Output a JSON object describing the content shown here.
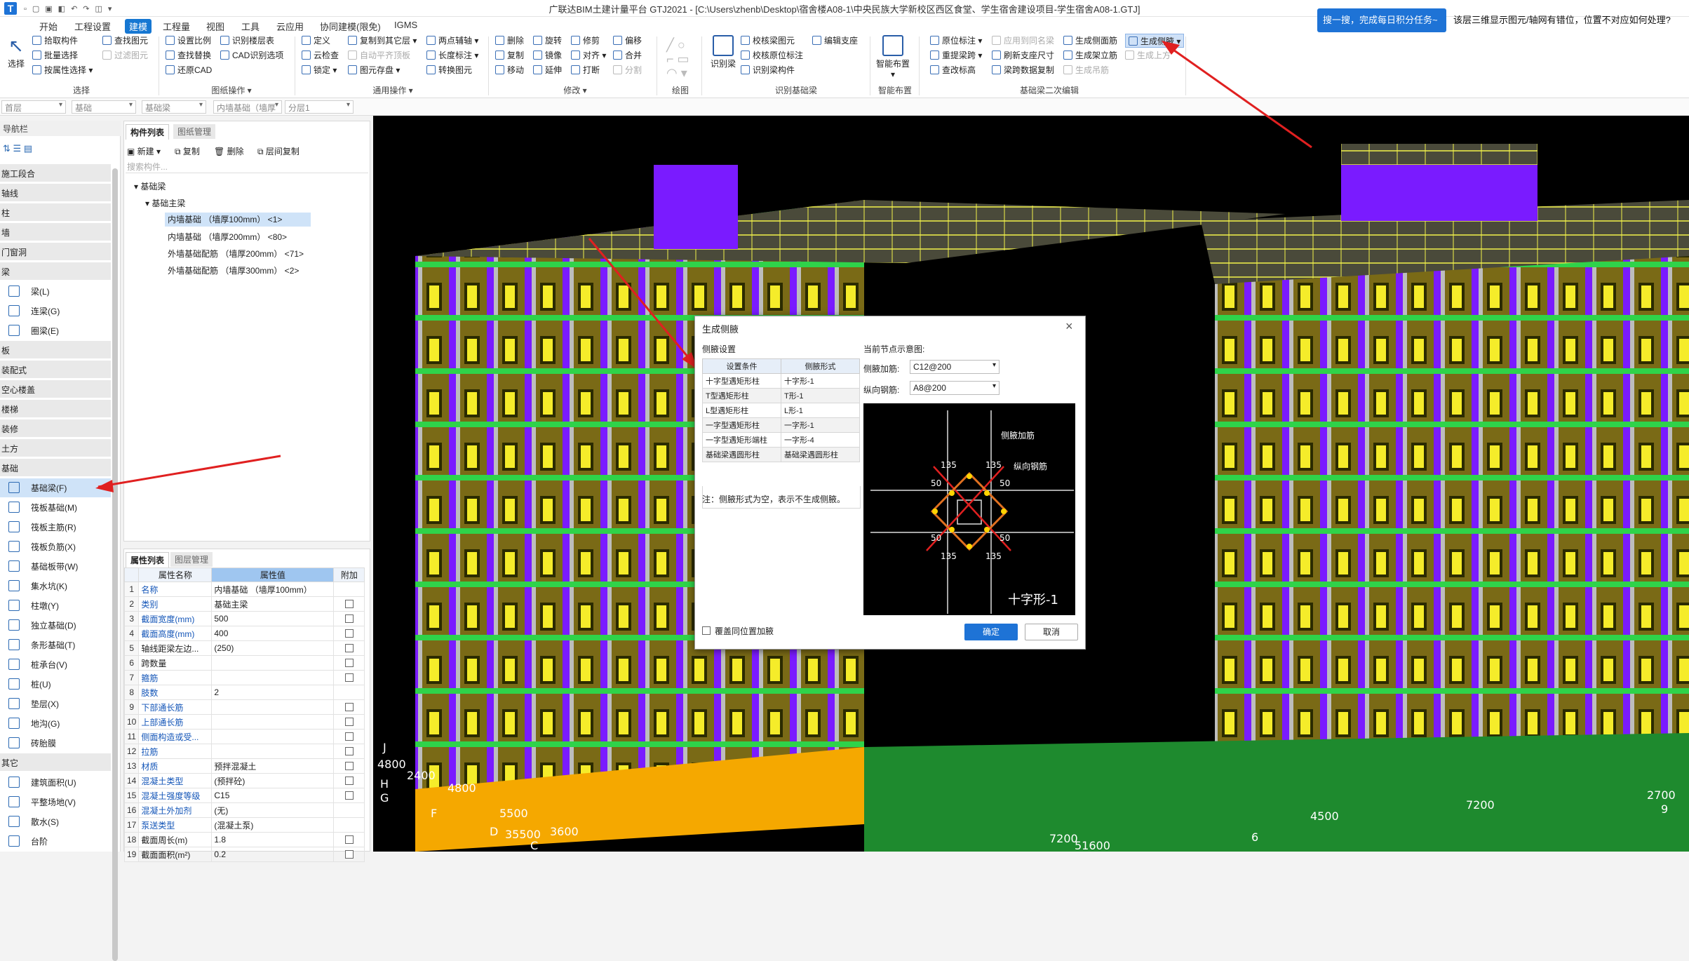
{
  "title": "广联达BIM土建计量平台 GTJ2021 - [C:\\Users\\zhenb\\Desktop\\宿舍楼A08-1\\中央民族大学新校区西区食堂、学生宿舍建设项目-学生宿舍A08-1.GTJ]",
  "menus": [
    "开始",
    "工程设置",
    "建模",
    "工程量",
    "视图",
    "工具",
    "云应用",
    "协同建模(限免)",
    "IGMS"
  ],
  "active_menu": "建模",
  "ribbon": {
    "select_big": "选择",
    "select_items": [
      "拾取构件",
      "批量选择",
      "按属性选择"
    ],
    "find_items": [
      "查找图元",
      "过滤图元"
    ],
    "drawing_items": [
      "设置比例",
      "查找替换",
      "还原CAD",
      "识别楼层表",
      "CAD识别选项"
    ],
    "common_items": [
      "定义",
      "云检查",
      "锁定",
      "复制到其它层",
      "自动平齐顶板",
      "图元存盘",
      "两点辅轴",
      "长度标注",
      "转换图元"
    ],
    "modify_items": [
      "删除",
      "复制",
      "移动",
      "旋转",
      "镜像",
      "延伸",
      "修剪",
      "对齐",
      "打断",
      "偏移",
      "合并",
      "分割"
    ],
    "recognize_big": "识别梁",
    "recognize_items": [
      "校核梁图元",
      "校核原位标注",
      "识别梁构件",
      "编辑支座"
    ],
    "smart_big": "智能布置",
    "beam2_items": [
      "原位标注",
      "重提梁跨",
      "查改标高",
      "应用到同名梁",
      "刷新支座尺寸",
      "梁跨数据复制",
      "生成侧面筋",
      "生成架立筋",
      "生成吊筋",
      "生成侧腋",
      "生成上方"
    ],
    "groups": [
      "选择",
      "图纸操作",
      "通用操作",
      "修改",
      "绘图",
      "识别基础梁",
      "智能布置",
      "基础梁二次编辑"
    ]
  },
  "toolstrip": [
    "首层",
    "基础",
    "基础梁",
    "内墙基础（墙厚",
    "分层1"
  ],
  "search_task": "搜一搜，完成每日积分任务~",
  "notice": "该层三维显示图元/轴网有错位，位置不对应如何处理?",
  "nav": {
    "header": "导航栏",
    "categories_top": [
      "施工段合",
      "轴线",
      "柱",
      "墙",
      "门窗洞",
      "梁"
    ],
    "beam_items": [
      "梁(L)",
      "连梁(G)",
      "圈梁(E)"
    ],
    "categories_mid": [
      "板",
      "装配式",
      "空心楼盖",
      "楼梯",
      "装修",
      "土方",
      "基础"
    ],
    "foundation_items": [
      "基础梁(F)",
      "筏板基础(M)",
      "筏板主筋(R)",
      "筏板负筋(X)",
      "基础板带(W)",
      "集水坑(K)",
      "柱墩(Y)",
      "独立基础(D)",
      "条形基础(T)",
      "桩承台(V)",
      "桩(U)",
      "垫层(X)",
      "地沟(G)",
      "砖胎膜"
    ],
    "categories_bot": [
      "其它"
    ],
    "other_items": [
      "建筑面积(U)",
      "平整场地(V)",
      "散水(S)",
      "台阶"
    ]
  },
  "complist": {
    "tabs": [
      "构件列表",
      "图纸管理"
    ],
    "toolbar": [
      "新建",
      "复制",
      "删除",
      "层间复制"
    ],
    "search_placeholder": "搜索构件...",
    "tree_root": "基础梁",
    "tree_sub": "基础主梁",
    "items": [
      "内墙基础 （墙厚100mm） <1>",
      "内墙基础 （墙厚200mm） <80>",
      "外墙基础配筋 （墙厚200mm） <71>",
      "外墙基础配筋 （墙厚300mm） <2>"
    ]
  },
  "props": {
    "tabs": [
      "属性列表",
      "图层管理"
    ],
    "headers": [
      "属性名称",
      "属性值",
      "附加"
    ],
    "rows": [
      {
        "n": "1",
        "name": "名称",
        "val": "内墙基础 （墙厚100mm）",
        "chk": false,
        "blue": true
      },
      {
        "n": "2",
        "name": "类别",
        "val": "基础主梁",
        "chk": true,
        "blue": true
      },
      {
        "n": "3",
        "name": "截面宽度(mm)",
        "val": "500",
        "chk": true,
        "blue": true
      },
      {
        "n": "4",
        "name": "截面高度(mm)",
        "val": "400",
        "chk": true,
        "blue": true
      },
      {
        "n": "5",
        "name": "轴线距梁左边...",
        "val": "(250)",
        "chk": true,
        "blue": false
      },
      {
        "n": "6",
        "name": "跨数量",
        "val": "",
        "chk": true,
        "blue": false
      },
      {
        "n": "7",
        "name": "箍筋",
        "val": "",
        "chk": true,
        "blue": true
      },
      {
        "n": "8",
        "name": "肢数",
        "val": "2",
        "chk": false,
        "blue": true
      },
      {
        "n": "9",
        "name": "下部通长筋",
        "val": "",
        "chk": true,
        "blue": true
      },
      {
        "n": "10",
        "name": "上部通长筋",
        "val": "",
        "chk": true,
        "blue": true
      },
      {
        "n": "11",
        "name": "侧面构造或受...",
        "val": "",
        "chk": true,
        "blue": true
      },
      {
        "n": "12",
        "name": "拉筋",
        "val": "",
        "chk": true,
        "blue": true
      },
      {
        "n": "13",
        "name": "材质",
        "val": "预拌混凝土",
        "chk": true,
        "blue": true
      },
      {
        "n": "14",
        "name": "混凝土类型",
        "val": "(预拌砼)",
        "chk": true,
        "blue": true
      },
      {
        "n": "15",
        "name": "混凝土强度等级",
        "val": "C15",
        "chk": true,
        "blue": true
      },
      {
        "n": "16",
        "name": "混凝土外加剂",
        "val": "(无)",
        "chk": false,
        "blue": true
      },
      {
        "n": "17",
        "name": "泵送类型",
        "val": "(混凝土泵)",
        "chk": false,
        "blue": true
      },
      {
        "n": "18",
        "name": "截面周长(m)",
        "val": "1.8",
        "chk": true,
        "blue": false
      },
      {
        "n": "19",
        "name": "截面面积(m²)",
        "val": "0.2",
        "chk": true,
        "blue": false
      }
    ]
  },
  "dialog": {
    "title": "生成侧腋",
    "section": "侧腋设置",
    "table_headers": [
      "设置条件",
      "侧腋形式"
    ],
    "table_rows": [
      [
        "十字型遇矩形柱",
        "十字形-1"
      ],
      [
        "T型遇矩形柱",
        "T形-1"
      ],
      [
        "L型遇矩形柱",
        "L形-1"
      ],
      [
        "一字型遇矩形柱",
        "一字形-1"
      ],
      [
        "一字型遇矩形端柱",
        "一字形-4"
      ],
      [
        "基础梁遇圆形柱",
        "基础梁遇圆形柱"
      ]
    ],
    "note": "注：侧腋形式为空，表示不生成侧腋。",
    "preview_label": "当前节点示意图:",
    "rebar1_label": "侧腋加筋:",
    "rebar1_value": "C12@200",
    "rebar2_label": "纵向钢筋:",
    "rebar2_value": "A8@200",
    "diagram_labels": {
      "a": "侧腋加筋",
      "b": "纵向钢筋",
      "c": "135",
      "d": "50",
      "e": "十字形-1"
    },
    "overwrite": "覆盖同位置加腋",
    "ok": "确定",
    "cancel": "取消"
  },
  "axis_labels": [
    "J",
    "4800",
    "2400",
    "4800",
    "H",
    "G",
    "F",
    "5500",
    "D",
    "35500",
    "3600",
    "C",
    "7200",
    "51600",
    "6",
    "4500",
    "7200",
    "2700",
    "9"
  ]
}
